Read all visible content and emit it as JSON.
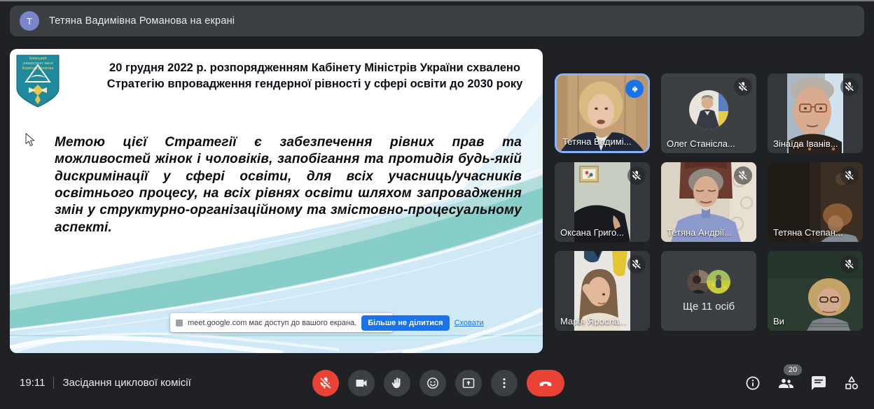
{
  "top_banner": {
    "avatar_letter": "T",
    "text": "Тетяна Вадимівна Романова на екрані"
  },
  "slide": {
    "logo_text": "Київський університет імені Бориса Грінченка",
    "title": "20 грудня 2022 р. розпорядженням Кабінету Міністрів України схвалено Стратегію впровадження гендерної рівності у сфері освіти до 2030 року",
    "body": "Метою цієї Стратегії є забезпечення рівних прав та можливостей жінок і чоловіків, запобігання та протидія будь-якій дискримінації у сфері освіти, для всіх учасниць/учасників освітнього процесу, на всіх рівнях освіти шляхом запровадження змін у структурно-організаційному та змістовно-процесуальному аспекті.",
    "share_notice": {
      "text": "meet.google.com має доступ до вашого екрана.",
      "stop_button": "Більше не ділитися",
      "hide_link": "Сховати"
    }
  },
  "tiles": [
    {
      "name": "Тетяна Вадимі...",
      "status": "speaking"
    },
    {
      "name": "Олег Станісла...",
      "status": "muted"
    },
    {
      "name": "Зінаїда Іванів...",
      "status": "muted"
    },
    {
      "name": "Оксана Григо...",
      "status": "muted"
    },
    {
      "name": "Тетяна Андрії...",
      "status": "muted"
    },
    {
      "name": "Тетяна Степан...",
      "status": "muted"
    },
    {
      "name": "Марія Яросла...",
      "status": "muted"
    },
    {
      "name": "Ще 11 осіб",
      "status": "overflow"
    },
    {
      "name": "Ви",
      "status": "muted"
    }
  ],
  "footer": {
    "time": "19:11",
    "meeting_name": "Засідання циклової комісії",
    "participant_count": "20"
  },
  "colors": {
    "page_bg": "#202124",
    "tile_bg": "#3c4043",
    "accent_border": "#8ab4f8",
    "speaker_blue": "#1a73e8",
    "danger_red": "#ea4335",
    "link_blue": "#1a73e8"
  }
}
